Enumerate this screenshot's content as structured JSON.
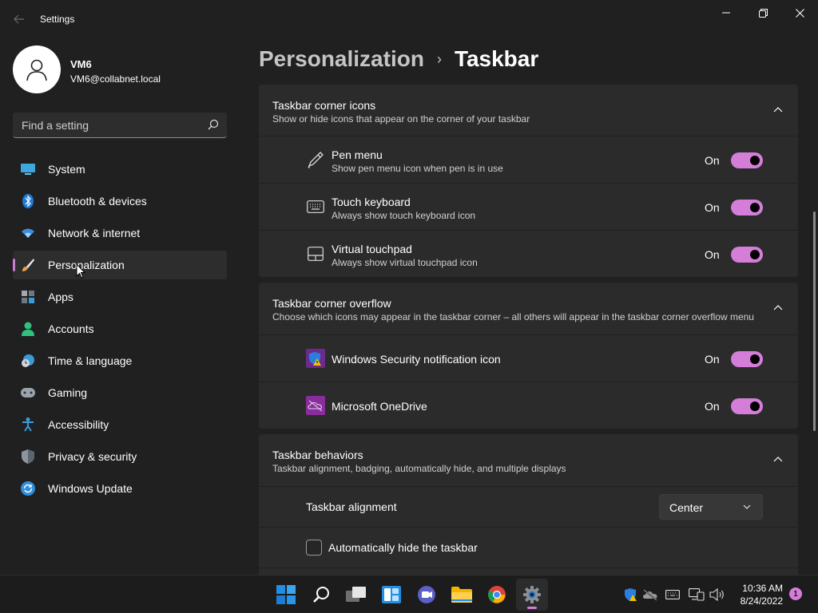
{
  "window": {
    "title": "Settings"
  },
  "user": {
    "name": "VM6",
    "email": "VM6@collabnet.local"
  },
  "search": {
    "placeholder": "Find a setting"
  },
  "sidebar": {
    "items": [
      {
        "label": "System",
        "icon": "system-icon"
      },
      {
        "label": "Bluetooth & devices",
        "icon": "bluetooth-icon"
      },
      {
        "label": "Network & internet",
        "icon": "wifi-icon"
      },
      {
        "label": "Personalization",
        "icon": "brush-icon",
        "selected": true
      },
      {
        "label": "Apps",
        "icon": "apps-icon"
      },
      {
        "label": "Accounts",
        "icon": "person-icon"
      },
      {
        "label": "Time & language",
        "icon": "clock-globe-icon"
      },
      {
        "label": "Gaming",
        "icon": "gamepad-icon"
      },
      {
        "label": "Accessibility",
        "icon": "accessibility-icon"
      },
      {
        "label": "Privacy & security",
        "icon": "shield-icon"
      },
      {
        "label": "Windows Update",
        "icon": "update-icon"
      }
    ],
    "accent_color": "#c87cd2"
  },
  "breadcrumb": {
    "parent": "Personalization",
    "separator": "›",
    "current": "Taskbar"
  },
  "sections": {
    "corner_icons": {
      "title": "Taskbar corner icons",
      "description": "Show or hide icons that appear on the corner of your taskbar",
      "items": [
        {
          "title": "Pen menu",
          "description": "Show pen menu icon when pen is in use",
          "state": "On",
          "icon": "pen-icon"
        },
        {
          "title": "Touch keyboard",
          "description": "Always show touch keyboard icon",
          "state": "On",
          "icon": "keyboard-icon"
        },
        {
          "title": "Virtual touchpad",
          "description": "Always show virtual touchpad icon",
          "state": "On",
          "icon": "touchpad-icon"
        }
      ]
    },
    "corner_overflow": {
      "title": "Taskbar corner overflow",
      "description": "Choose which icons may appear in the taskbar corner – all others will appear in the taskbar corner overflow menu",
      "items": [
        {
          "title": "Windows Security notification icon",
          "state": "On",
          "icon": "windows-security-icon"
        },
        {
          "title": "Microsoft OneDrive",
          "state": "On",
          "icon": "onedrive-icon"
        }
      ]
    },
    "behaviors": {
      "title": "Taskbar behaviors",
      "description": "Taskbar alignment, badging, automatically hide, and multiple displays",
      "alignment_label": "Taskbar alignment",
      "alignment_value": "Center",
      "auto_hide_label": "Automatically hide the taskbar"
    }
  },
  "toggle_color": "#d47ed9",
  "taskbar": {
    "apps": [
      "start-icon",
      "search-icon",
      "task-view-icon",
      "widgets-icon",
      "teams-chat-icon",
      "file-explorer-icon",
      "chrome-icon",
      "settings-icon"
    ],
    "time": "10:36 AM",
    "date": "8/24/2022",
    "notification_count": "1"
  }
}
